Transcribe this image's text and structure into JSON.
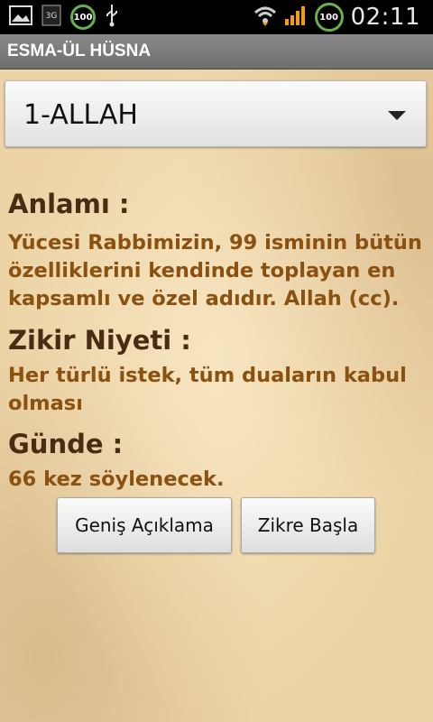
{
  "status_bar": {
    "time": "02:11",
    "battery_small": "100",
    "battery_main": "100",
    "network": "3G",
    "icons": [
      "gallery-icon",
      "3g-icon",
      "battery-ring-icon",
      "usb-icon",
      "wifi-icon",
      "signal-icon",
      "battery-ring-icon"
    ]
  },
  "app": {
    "title": "ESMA-ÜL HÜSNA"
  },
  "selector": {
    "selected": "1-ALLAH"
  },
  "sections": {
    "meaning_heading": "Anlamı :",
    "meaning_text": "Yücesi Rabbimizin, 99 isminin bütün özelliklerini kendinde toplayan en kapsamlı ve özel adıdır.  Allah (cc).",
    "intention_heading": "Zikir Niyeti :",
    "intention_text": "Her türlü istek, tüm duaların kabul olması",
    "daily_heading": "Günde :",
    "daily_text": "66  kez söylenecek."
  },
  "buttons": {
    "details": "Geniş Açıklama",
    "start": "Zikre Başla"
  },
  "colors": {
    "heading": "#4a2c12",
    "body": "#8a5110",
    "parchment": "#ecd4a6"
  }
}
